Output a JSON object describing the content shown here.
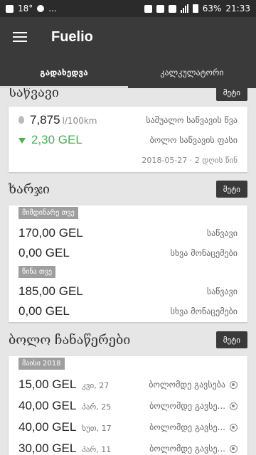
{
  "status_bar": {
    "temperature": "18°",
    "dots": "...",
    "battery_percent": "63%",
    "time": "21:33"
  },
  "app_bar": {
    "title": "Fuelio"
  },
  "tabs": [
    {
      "label": "გადახედვა",
      "active": true
    },
    {
      "label": "კალკულატორი",
      "active": false
    }
  ],
  "fuel_section": {
    "title": "საწვავი",
    "more_label": "მეტი",
    "consumption_value": "7,875",
    "consumption_unit": "l/100km",
    "consumption_label": "საშუალო საწვავის წვა",
    "price_value": "2,30 GEL",
    "price_label": "ბოლო საწვავის ფასი",
    "date_text": "2018-05-27 · 2 დღის წინ"
  },
  "costs_section": {
    "title": "ხარჯი",
    "more_label": "მეტი",
    "current_month_chip": "მიმდინარე თვე",
    "current_fuel_value": "170,00 GEL",
    "current_fuel_label": "საწვავი",
    "current_other_value": "0,00 GEL",
    "current_other_label": "სხვა მონაცემები",
    "prev_month_chip": "წინა თვე",
    "prev_fuel_value": "185,00 GEL",
    "prev_fuel_label": "საწვავი",
    "prev_other_value": "0,00 GEL",
    "prev_other_label": "სხვა მონაცემები"
  },
  "records_section": {
    "title": "ბოლო ჩანაწერები",
    "more_label": "მეტი",
    "month_chip": "მაისი 2018",
    "records": [
      {
        "amount": "15,00 GEL",
        "day": "კვი, 27",
        "label": "ბოლომდე გავსება"
      },
      {
        "amount": "40,00 GEL",
        "day": "პარ, 25",
        "label": "ბოლომდე გავსე..."
      },
      {
        "amount": "40,00 GEL",
        "day": "ხუთ, 17",
        "label": "ბოლომდე გავსე..."
      },
      {
        "amount": "30,00 GEL",
        "day": "პარ, 11",
        "label": "ბოლომდე გავსე..."
      }
    ]
  },
  "colors": {
    "app_bar": "#3a3a3a",
    "accent_green": "#4caf50",
    "chip_gray": "#9e9e9e"
  }
}
